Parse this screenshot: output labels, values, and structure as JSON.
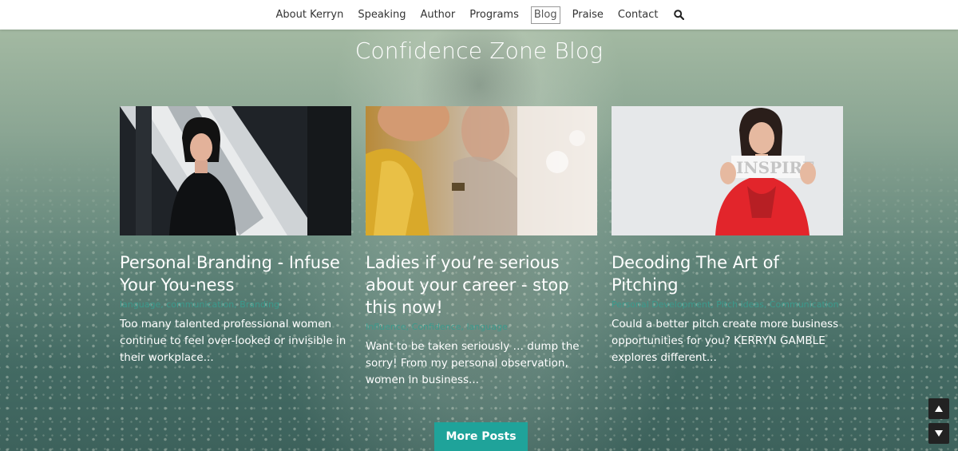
{
  "nav": {
    "items": [
      {
        "label": "About Kerryn",
        "active": false
      },
      {
        "label": "Speaking",
        "active": false
      },
      {
        "label": "Author",
        "active": false
      },
      {
        "label": "Programs",
        "active": false
      },
      {
        "label": "Blog",
        "active": true
      },
      {
        "label": "Praise",
        "active": false
      },
      {
        "label": "Contact",
        "active": false
      }
    ],
    "search_icon": "search-icon"
  },
  "hero": {
    "title": "Confidence Zone Blog"
  },
  "posts": [
    {
      "title": "Personal Branding - Infuse Your You-ness",
      "tags": "language, communication, Branding",
      "excerpt": "Too many talented professional women continue to feel over-looked or invisible in their workplace..."
    },
    {
      "title": "Ladies if you’re serious about your career - stop this now!",
      "tags": "Influence, Confidence, language",
      "excerpt": "Want to be taken seriously … dump the sorry! From my personal observation, women in business..."
    },
    {
      "title": "Decoding The Art of Pitching",
      "tags": "Personal Development, Pitch ideas, Communication",
      "excerpt": "Could a better pitch create more business opportunities for you? KERRYN GAMBLE explores different..."
    }
  ],
  "more_button": "More Posts",
  "scroll": {
    "up_icon": "arrow-up-icon",
    "down_icon": "arrow-down-icon"
  },
  "colors": {
    "accent": "#1fa39a",
    "tag": "#3b9a8c"
  }
}
